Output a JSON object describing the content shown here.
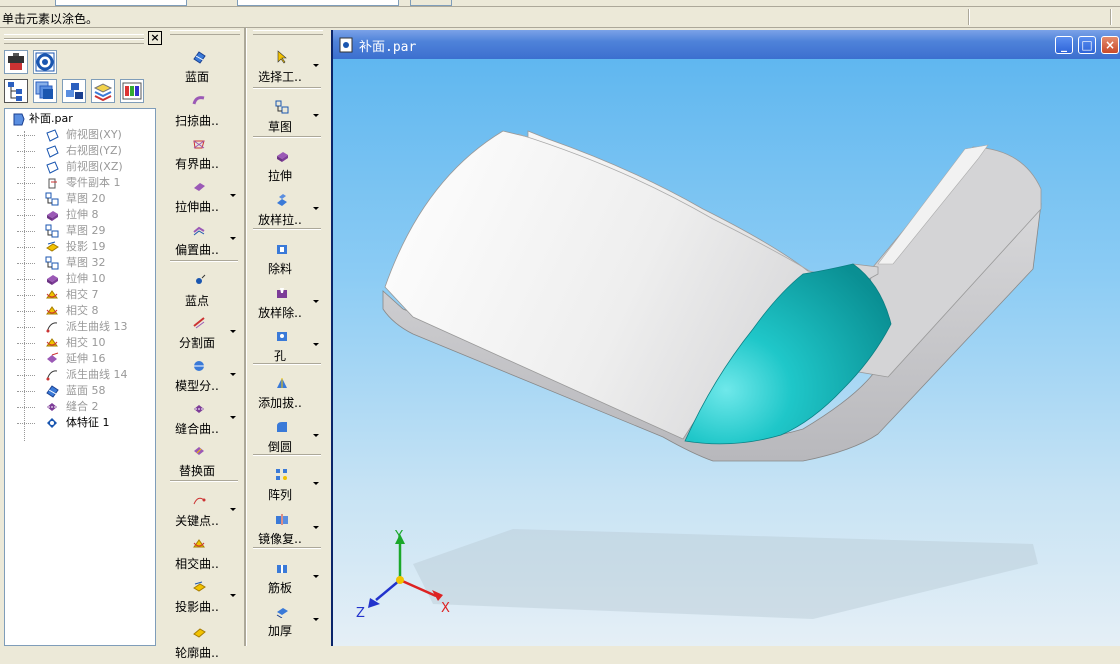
{
  "status": {
    "text": "单击元素以涂色。"
  },
  "panel": {
    "close_label": "×",
    "tree": [
      {
        "label": "补面.par",
        "icon": "part-icon",
        "active": true,
        "root": true
      },
      {
        "label": "俯视图(XY)",
        "icon": "plane-icon"
      },
      {
        "label": "右视图(YZ)",
        "icon": "plane-icon"
      },
      {
        "label": "前视图(XZ)",
        "icon": "plane-icon"
      },
      {
        "label": "零件副本 1",
        "icon": "part-copy-icon"
      },
      {
        "label": "草图 20",
        "icon": "sketch-icon"
      },
      {
        "label": "拉伸 8",
        "icon": "extrude-icon"
      },
      {
        "label": "草图 29",
        "icon": "sketch-icon"
      },
      {
        "label": "投影 19",
        "icon": "project-icon"
      },
      {
        "label": "草图 32",
        "icon": "sketch-icon"
      },
      {
        "label": "拉伸 10",
        "icon": "extrude-icon"
      },
      {
        "label": "相交 7",
        "icon": "intersect-icon"
      },
      {
        "label": "相交 8",
        "icon": "intersect-icon"
      },
      {
        "label": "派生曲线 13",
        "icon": "derived-curve-icon"
      },
      {
        "label": "相交 10",
        "icon": "intersect-icon"
      },
      {
        "label": "延伸 16",
        "icon": "extend-icon"
      },
      {
        "label": "派生曲线 14",
        "icon": "derived-curve-icon"
      },
      {
        "label": "蓝面 58",
        "icon": "bluesurf-icon"
      },
      {
        "label": "缝合 2",
        "icon": "stitch-icon"
      },
      {
        "label": "体特征 1",
        "icon": "body-feature-icon",
        "active": true
      }
    ]
  },
  "toolbar_surface": [
    {
      "label": "蓝面",
      "icon": "bluesurf-icon",
      "arrow": false
    },
    {
      "label": "扫掠曲..",
      "icon": "sweep-icon",
      "arrow": false
    },
    {
      "label": "有界曲..",
      "icon": "bounded-icon",
      "arrow": false
    },
    {
      "label": "拉伸曲..",
      "icon": "extrude-surface-icon",
      "arrow": true
    },
    {
      "label": "偏置曲..",
      "icon": "offset-icon",
      "arrow": true
    },
    {
      "label": "蓝点",
      "icon": "bluedot-icon",
      "arrow": false
    },
    {
      "label": "分割面",
      "icon": "split-face-icon",
      "arrow": true
    },
    {
      "label": "模型分..",
      "icon": "model-split-icon",
      "arrow": true
    },
    {
      "label": "缝合曲..",
      "icon": "stitch-icon",
      "arrow": true
    },
    {
      "label": "替换面",
      "icon": "replace-face-icon",
      "arrow": false
    },
    {
      "label": "关键点..",
      "icon": "keypoint-icon",
      "arrow": true
    },
    {
      "label": "相交曲..",
      "icon": "intersect-icon",
      "arrow": false
    },
    {
      "label": "投影曲..",
      "icon": "project-icon",
      "arrow": true
    },
    {
      "label": "轮廓曲..",
      "icon": "contour-icon",
      "arrow": false
    }
  ],
  "toolbar_feature": [
    {
      "label": "选择工..",
      "icon": "select-tool-icon",
      "arrow": true
    },
    {
      "label": "草图",
      "icon": "sketch-icon",
      "arrow": true
    },
    {
      "label": "拉伸",
      "icon": "extrude-icon",
      "arrow": false
    },
    {
      "label": "放样拉..",
      "icon": "loft-icon",
      "arrow": true
    },
    {
      "label": "除料",
      "icon": "cutout-icon",
      "arrow": false
    },
    {
      "label": "放样除..",
      "icon": "loft-cut-icon",
      "arrow": true
    },
    {
      "label": "孔",
      "icon": "hole-icon",
      "arrow": true
    },
    {
      "label": "添加拔..",
      "icon": "draft-icon",
      "arrow": false
    },
    {
      "label": "倒圆",
      "icon": "round-icon",
      "arrow": true
    },
    {
      "label": "阵列",
      "icon": "pattern-icon",
      "arrow": true
    },
    {
      "label": "镜像复..",
      "icon": "mirror-icon",
      "arrow": true
    },
    {
      "label": "筋板",
      "icon": "rib-icon",
      "arrow": true
    },
    {
      "label": "加厚",
      "icon": "thicken-icon",
      "arrow": true
    }
  ],
  "window": {
    "title": "补面.par",
    "min_label": "_",
    "max_label": "□",
    "close_label": "×"
  },
  "axes": {
    "x": "X",
    "y": "Y",
    "z": "Z"
  },
  "colors": {
    "background_top": "#5ab4ef",
    "part_body": "#e8e8ec",
    "selected_face": "#12b4b6"
  }
}
